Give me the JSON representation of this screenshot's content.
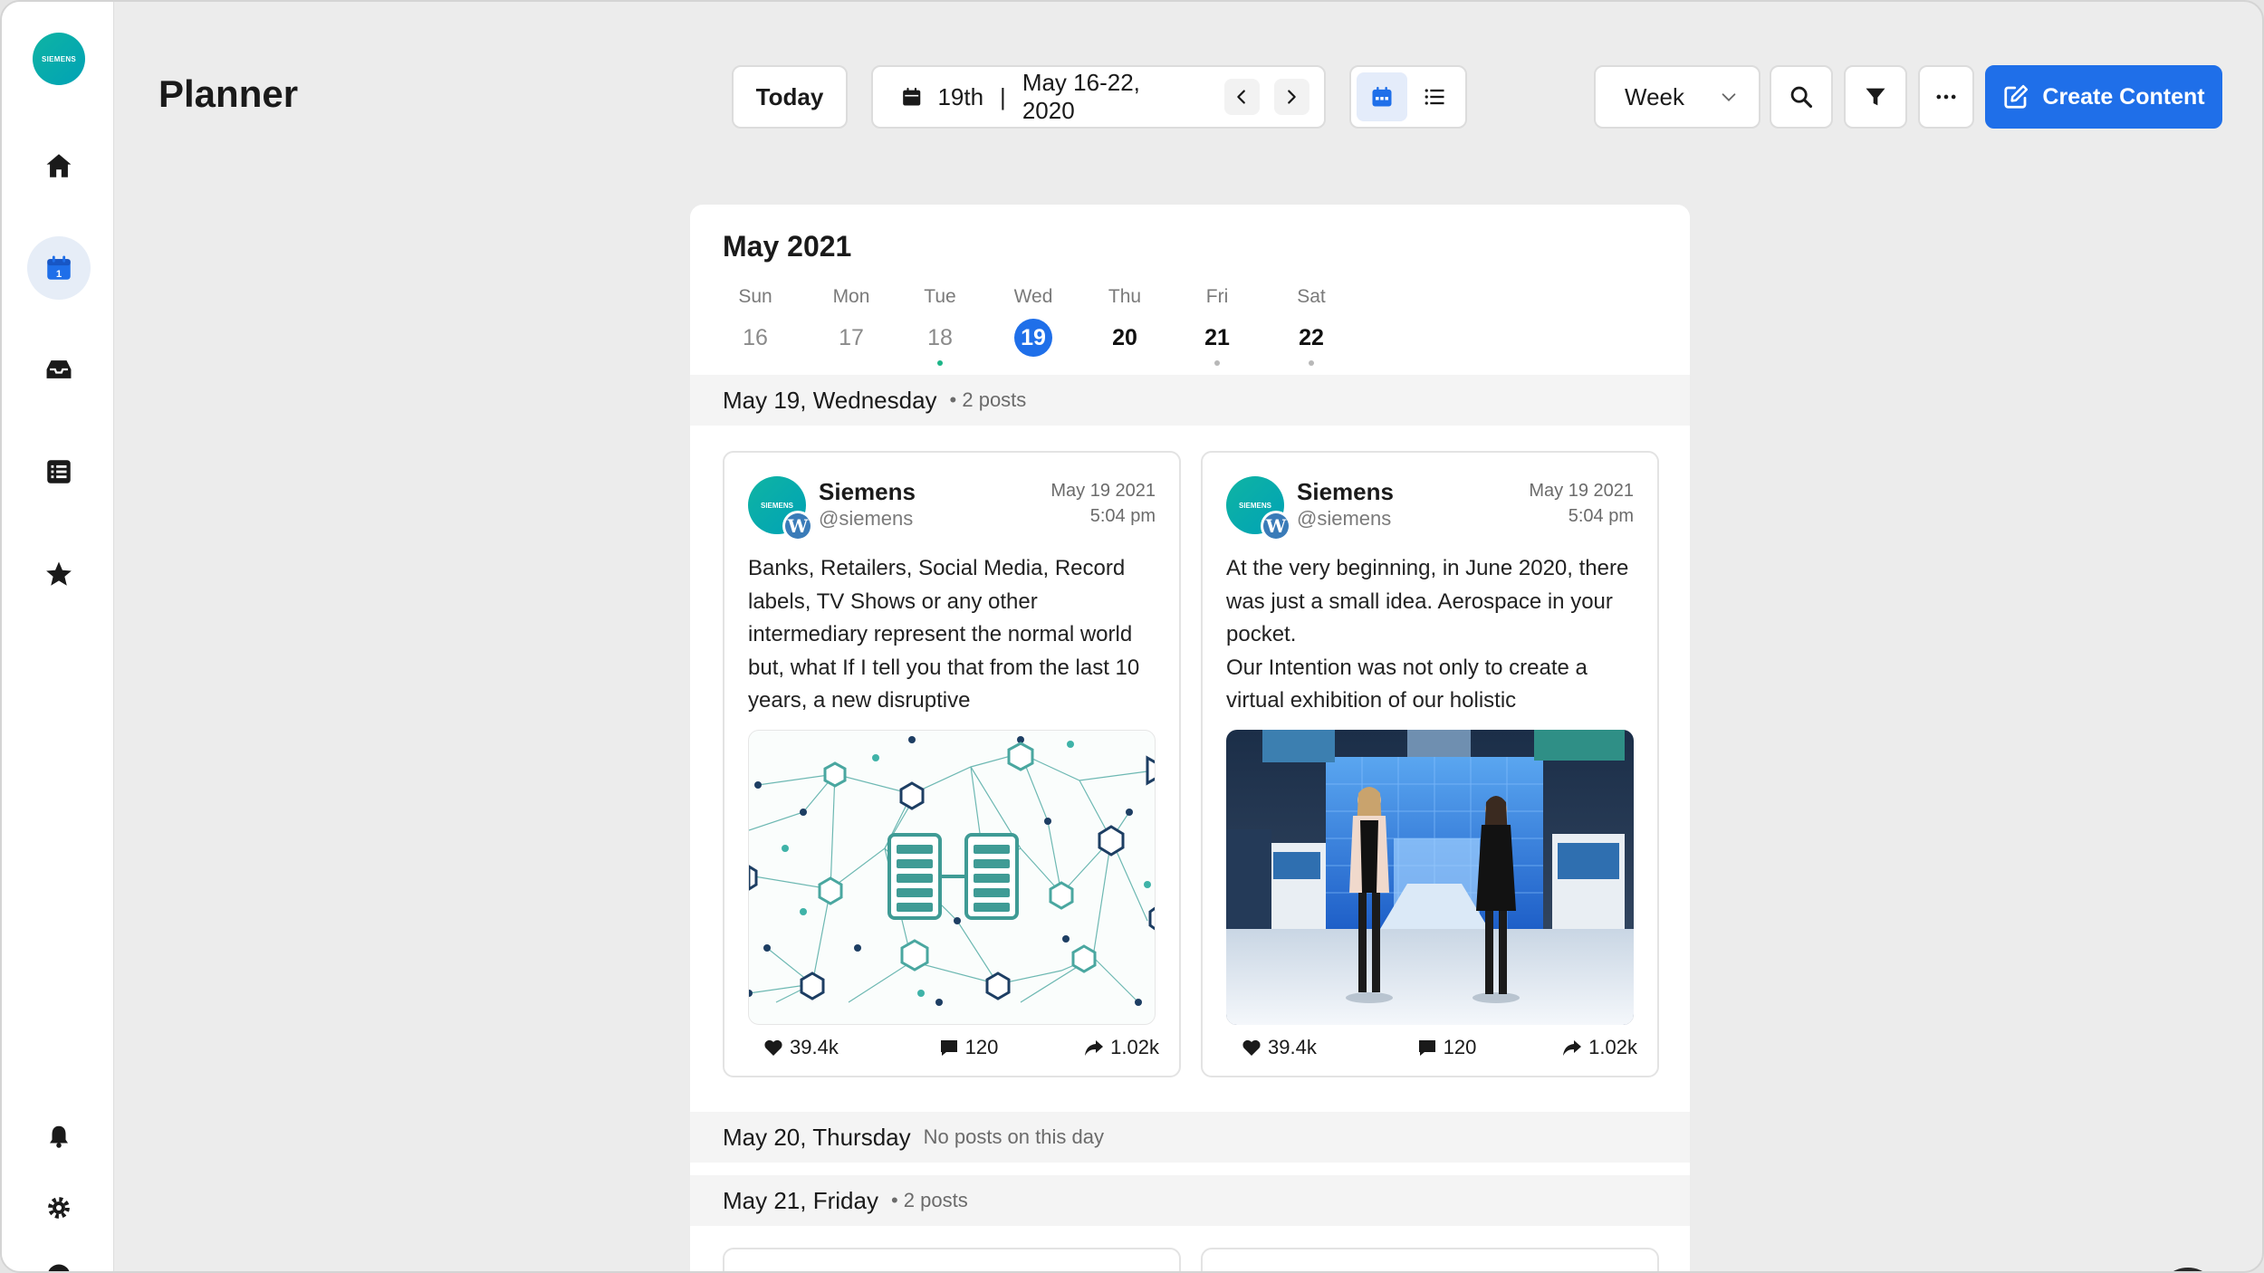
{
  "app": {
    "logo_text": "SIEMENS"
  },
  "sidebar": {
    "items": [
      {
        "name": "home",
        "icon": "home-icon",
        "active": false
      },
      {
        "name": "planner",
        "icon": "calendar-icon",
        "active": true
      },
      {
        "name": "inbox",
        "icon": "inbox-icon",
        "active": false
      },
      {
        "name": "content-list",
        "icon": "list-icon",
        "active": false
      },
      {
        "name": "favorites",
        "icon": "star-icon",
        "active": false
      }
    ],
    "bottom": [
      {
        "name": "notifications",
        "icon": "bell-icon"
      },
      {
        "name": "settings",
        "icon": "gear-icon"
      },
      {
        "name": "help",
        "icon": "help-icon"
      }
    ],
    "calendar_icon_day": "1"
  },
  "header": {
    "title": "Planner",
    "today_label": "Today",
    "date_day": "19th",
    "date_separator": "|",
    "date_range": "May 16-22, 2020",
    "view_select": "Week",
    "create_label": "Create Content"
  },
  "calendar": {
    "month_title": "May 2021",
    "days": [
      {
        "dow": "Sun",
        "num": "16",
        "style": "muted",
        "dot": ""
      },
      {
        "dow": "Mon",
        "num": "17",
        "style": "muted",
        "dot": ""
      },
      {
        "dow": "Tue",
        "num": "18",
        "style": "muted",
        "dot": "green"
      },
      {
        "dow": "Wed",
        "num": "19",
        "style": "selected",
        "dot": ""
      },
      {
        "dow": "Thu",
        "num": "20",
        "style": "dark",
        "dot": ""
      },
      {
        "dow": "Fri",
        "num": "21",
        "style": "dark",
        "dot": "grey"
      },
      {
        "dow": "Sat",
        "num": "22",
        "style": "dark",
        "dot": "grey"
      }
    ],
    "sections": [
      {
        "date": "May 19, Wednesday",
        "meta": "• 2 posts"
      },
      {
        "date": "May 20, Thursday",
        "meta": "No posts on this day"
      },
      {
        "date": "May 21, Friday",
        "meta": "• 2 posts"
      }
    ],
    "posts": [
      {
        "author": "Siemens",
        "handle": "@siemens",
        "date": "May 19 2021",
        "time": "5:04 pm",
        "avatar_text": "SIEMENS",
        "text": "Banks, Retailers, Social Media, Record labels, TV Shows or any other intermediary represent the normal world but, what If I tell you that from the last 10 years, a new disruptive",
        "likes": "39.4k",
        "comments": "120",
        "shares": "1.02k"
      },
      {
        "author": "Siemens",
        "handle": "@siemens",
        "date": "May 19 2021",
        "time": "5:04 pm",
        "avatar_text": "SIEMENS",
        "text": "At the very beginning, in June 2020, there was just a small idea. Aerospace in your pocket.\nOur Intention was not only to create a virtual exhibition of our holistic",
        "likes": "39.4k",
        "comments": "120",
        "shares": "1.02k"
      }
    ]
  },
  "colors": {
    "accent": "#1f6fe9",
    "brand_teal": "#0fb4a3",
    "event_dot": "#1db588"
  }
}
